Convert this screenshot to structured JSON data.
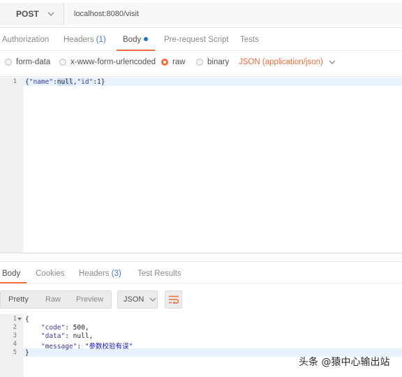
{
  "request": {
    "method": "POST",
    "url": "localhost:8080/visit"
  },
  "request_tabs": [
    {
      "label": "Authorization"
    },
    {
      "label": "Headers ",
      "count": "(1)"
    },
    {
      "label": "Body",
      "active": true
    },
    {
      "label": "Pre-request Script"
    },
    {
      "label": "Tests"
    }
  ],
  "body_types": {
    "form_data": "form-data",
    "urlencoded": "x-www-form-urlencoded",
    "raw": "raw",
    "binary": "binary",
    "selected": "raw",
    "content_type": "JSON (application/json)"
  },
  "request_body": {
    "line_numbers": [
      "1"
    ],
    "lines": [
      "{\"name\":null,\"id\":1}"
    ]
  },
  "response_tabs": [
    {
      "label": "Body",
      "active": true
    },
    {
      "label": "Cookies"
    },
    {
      "label": "Headers ",
      "count": "(3)"
    },
    {
      "label": "Test Results"
    }
  ],
  "response_view": {
    "modes": [
      "Pretty",
      "Raw",
      "Preview"
    ],
    "selected": "Pretty",
    "format": "JSON"
  },
  "response_body": {
    "line_numbers": [
      "1",
      "2",
      "3",
      "4",
      "5"
    ],
    "lines": [
      "{",
      "    \"code\": 500,",
      "    \"data\": null,",
      "    \"message\": \"参数校验有误\"",
      "}"
    ]
  },
  "watermark": "头条 @猿中心输出站",
  "colors": {
    "accent": "#f26b3a",
    "count_blue": "#3f78c9",
    "body_dot": "#1676d2"
  }
}
